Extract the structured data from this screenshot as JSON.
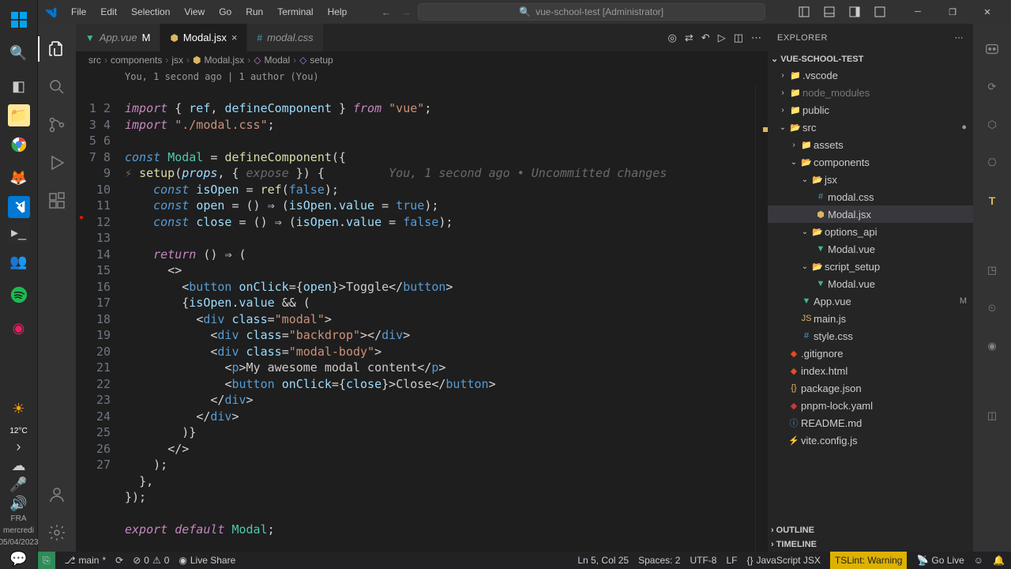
{
  "window": {
    "title": "vue-school-test [Administrator]"
  },
  "menu": {
    "file": "File",
    "edit": "Edit",
    "selection": "Selection",
    "view": "View",
    "go": "Go",
    "run": "Run",
    "terminal": "Terminal",
    "help": "Help"
  },
  "tabs": [
    {
      "name": "App.vue",
      "modified": "M",
      "active": false
    },
    {
      "name": "Modal.jsx",
      "modified": "",
      "active": true
    },
    {
      "name": "modal.css",
      "modified": "",
      "active": false
    }
  ],
  "breadcrumb": {
    "p1": "src",
    "p2": "components",
    "p3": "jsx",
    "p4": "Modal.jsx",
    "p5": "Modal",
    "p6": "setup"
  },
  "code_lens": "You, 1 second ago | 1 author (You)",
  "inline_blame": "You, 1 second ago • Uncommitted changes",
  "explorer": {
    "header": "EXPLORER",
    "project": "VUE-SCHOOL-TEST",
    "outline": "OUTLINE",
    "timeline": "TIMELINE",
    "items": {
      "vscode": ".vscode",
      "node_modules": "node_modules",
      "public": "public",
      "src": "src",
      "assets": "assets",
      "components": "components",
      "jsx": "jsx",
      "modal_css": "modal.css",
      "modal_jsx": "Modal.jsx",
      "options_api": "options_api",
      "modal_vue1": "Modal.vue",
      "script_setup": "script_setup",
      "modal_vue2": "Modal.vue",
      "app_vue": "App.vue",
      "app_badge": "M",
      "main_js": "main.js",
      "style_css": "style.css",
      "gitignore": ".gitignore",
      "index_html": "index.html",
      "package_json": "package.json",
      "pnpm_lock": "pnpm-lock.yaml",
      "readme": "README.md",
      "vite_config": "vite.config.js"
    }
  },
  "code": {
    "l1_import": "import",
    "l1_ref": "ref",
    "l1_dc": "defineComponent",
    "l1_from": "from",
    "l1_vue": "\"vue\"",
    "l2_css": "\"./modal.css\"",
    "l4_const": "const",
    "l4_modal": "Modal",
    "l5_setup": "setup",
    "l5_props": "props",
    "l5_expose": "expose",
    "l6_isopen": "isOpen",
    "l6_ref": "ref",
    "l6_false": "false",
    "l7_open": "open",
    "l7_val": "isOpen",
    "l7_value": "value",
    "l7_true": "true",
    "l8_close": "close",
    "l8_false": "false",
    "l10_return": "return",
    "l12_button": "button",
    "l12_onclick": "onClick",
    "l12_open": "open",
    "l12_toggle": "Toggle",
    "l13_isopen": "isOpen",
    "l13_value": "value",
    "l14_div": "div",
    "l14_class": "class",
    "l14_modal": "\"modal\"",
    "l15_backdrop": "\"backdrop\"",
    "l16_body": "\"modal-body\"",
    "l17_p": "p",
    "l17_text": "My awesome modal content",
    "l18_close": "close",
    "l18_closetext": "Close",
    "l27_export": "export",
    "l27_default": "default"
  },
  "status": {
    "branch": "main",
    "sync": "",
    "errors": "0",
    "warnings": "0",
    "lncol": "Ln 5, Col 25",
    "spaces": "Spaces: 2",
    "encoding": "UTF-8",
    "eol": "LF",
    "lang": "JavaScript JSX",
    "tslint": "TSLint: Warning",
    "port": "Go Live",
    "liveshare": "Live Share",
    "bell": ""
  },
  "taskbar": {
    "temp": "12°C",
    "day": "mercredi",
    "date": "05/04/2023",
    "kb": "FRA"
  },
  "chart_data": null
}
